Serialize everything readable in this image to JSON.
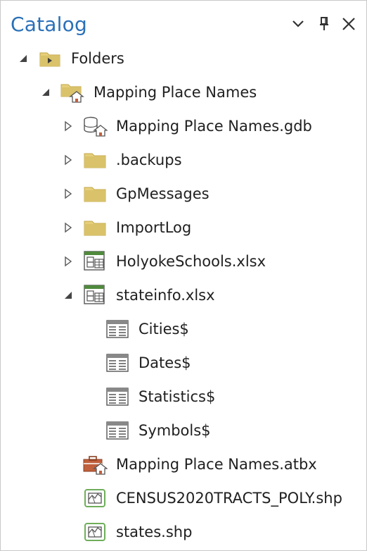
{
  "pane": {
    "title": "Catalog",
    "buttons": {
      "options": "chevron-down-icon",
      "pin": "pin-icon",
      "close": "close-icon"
    }
  },
  "colors": {
    "title": "#2a71b8",
    "folder": "#d9c26a",
    "toolbox": "#c0603c",
    "shapefile": "#6fae5a"
  },
  "tree": [
    {
      "label": "Folders",
      "icon": "folders-icon",
      "expander": "expanded"
    },
    {
      "label": "Mapping Place Names",
      "icon": "home-folder-icon",
      "expander": "expanded"
    },
    {
      "label": "Mapping Place Names.gdb",
      "icon": "geodatabase-icon",
      "expander": "collapsed"
    },
    {
      "label": ".backups",
      "icon": "folder-icon",
      "expander": "collapsed"
    },
    {
      "label": "GpMessages",
      "icon": "folder-icon",
      "expander": "collapsed"
    },
    {
      "label": "ImportLog",
      "icon": "folder-icon",
      "expander": "collapsed"
    },
    {
      "label": "HolyokeSchools.xlsx",
      "icon": "excel-workbook-icon",
      "expander": "collapsed"
    },
    {
      "label": "stateinfo.xlsx",
      "icon": "excel-workbook-icon",
      "expander": "expanded"
    },
    {
      "label": "Cities$",
      "icon": "table-icon",
      "expander": "none"
    },
    {
      "label": "Dates$",
      "icon": "table-icon",
      "expander": "none"
    },
    {
      "label": "Statistics$",
      "icon": "table-icon",
      "expander": "none"
    },
    {
      "label": "Symbols$",
      "icon": "table-icon",
      "expander": "none"
    },
    {
      "label": "Mapping Place Names.atbx",
      "icon": "toolbox-icon",
      "expander": "none"
    },
    {
      "label": "CENSUS2020TRACTS_POLY.shp",
      "icon": "shapefile-icon",
      "expander": "none"
    },
    {
      "label": "states.shp",
      "icon": "shapefile-icon",
      "expander": "none"
    }
  ]
}
